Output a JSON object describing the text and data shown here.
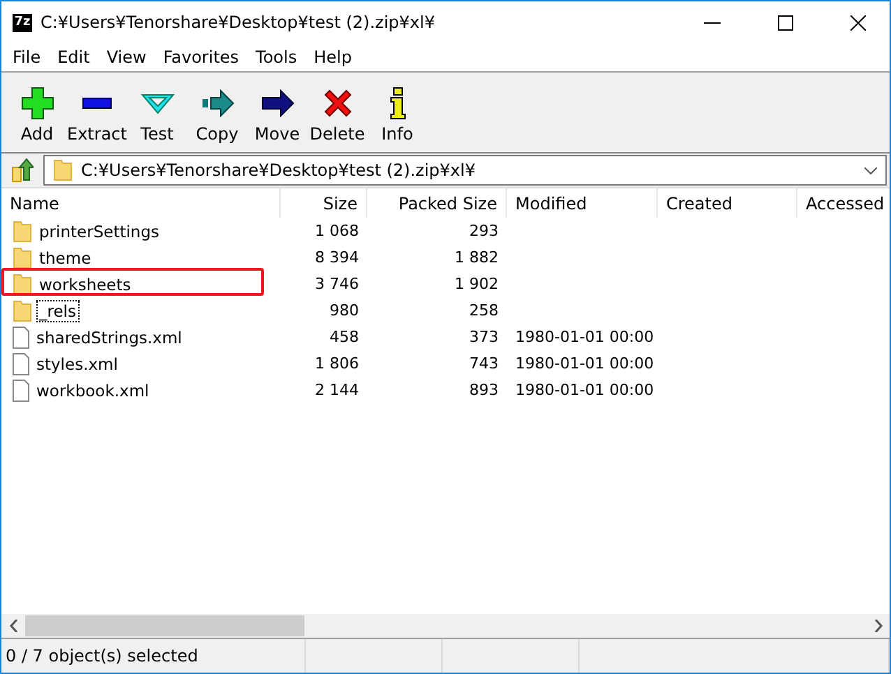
{
  "window": {
    "title": "C:¥Users¥Tenorshare¥Desktop¥test (2).zip¥xl¥",
    "app_icon": "7z"
  },
  "menu": [
    "File",
    "Edit",
    "View",
    "Favorites",
    "Tools",
    "Help"
  ],
  "toolbar": [
    {
      "kind": "add",
      "label": "Add"
    },
    {
      "kind": "extract",
      "label": "Extract"
    },
    {
      "kind": "test",
      "label": "Test"
    },
    {
      "kind": "copy",
      "label": "Copy"
    },
    {
      "kind": "move",
      "label": "Move"
    },
    {
      "kind": "delete",
      "label": "Delete"
    },
    {
      "kind": "info",
      "label": "Info"
    }
  ],
  "address": {
    "value": "C:¥Users¥Tenorshare¥Desktop¥test (2).zip¥xl¥"
  },
  "table": {
    "columns": [
      "Name",
      "Size",
      "Packed Size",
      "Modified",
      "Created",
      "Accessed"
    ],
    "rows": [
      {
        "kind": "folder",
        "name": "printerSettings",
        "size": "1 068",
        "packed": "293",
        "modified": "",
        "highlighted": false,
        "focused": false
      },
      {
        "kind": "folder",
        "name": "theme",
        "size": "8 394",
        "packed": "1 882",
        "modified": "",
        "highlighted": false,
        "focused": false
      },
      {
        "kind": "folder",
        "name": "worksheets",
        "size": "3 746",
        "packed": "1 902",
        "modified": "",
        "highlighted": true,
        "focused": false
      },
      {
        "kind": "folder",
        "name": "_rels",
        "size": "980",
        "packed": "258",
        "modified": "",
        "highlighted": false,
        "focused": true
      },
      {
        "kind": "file",
        "name": "sharedStrings.xml",
        "size": "458",
        "packed": "373",
        "modified": "1980-01-01 00:00",
        "highlighted": false,
        "focused": false
      },
      {
        "kind": "file",
        "name": "styles.xml",
        "size": "1 806",
        "packed": "743",
        "modified": "1980-01-01 00:00",
        "highlighted": false,
        "focused": false
      },
      {
        "kind": "file",
        "name": "workbook.xml",
        "size": "2 144",
        "packed": "893",
        "modified": "1980-01-01 00:00",
        "highlighted": false,
        "focused": false
      }
    ]
  },
  "status_bar": "0 / 7 object(s) selected"
}
